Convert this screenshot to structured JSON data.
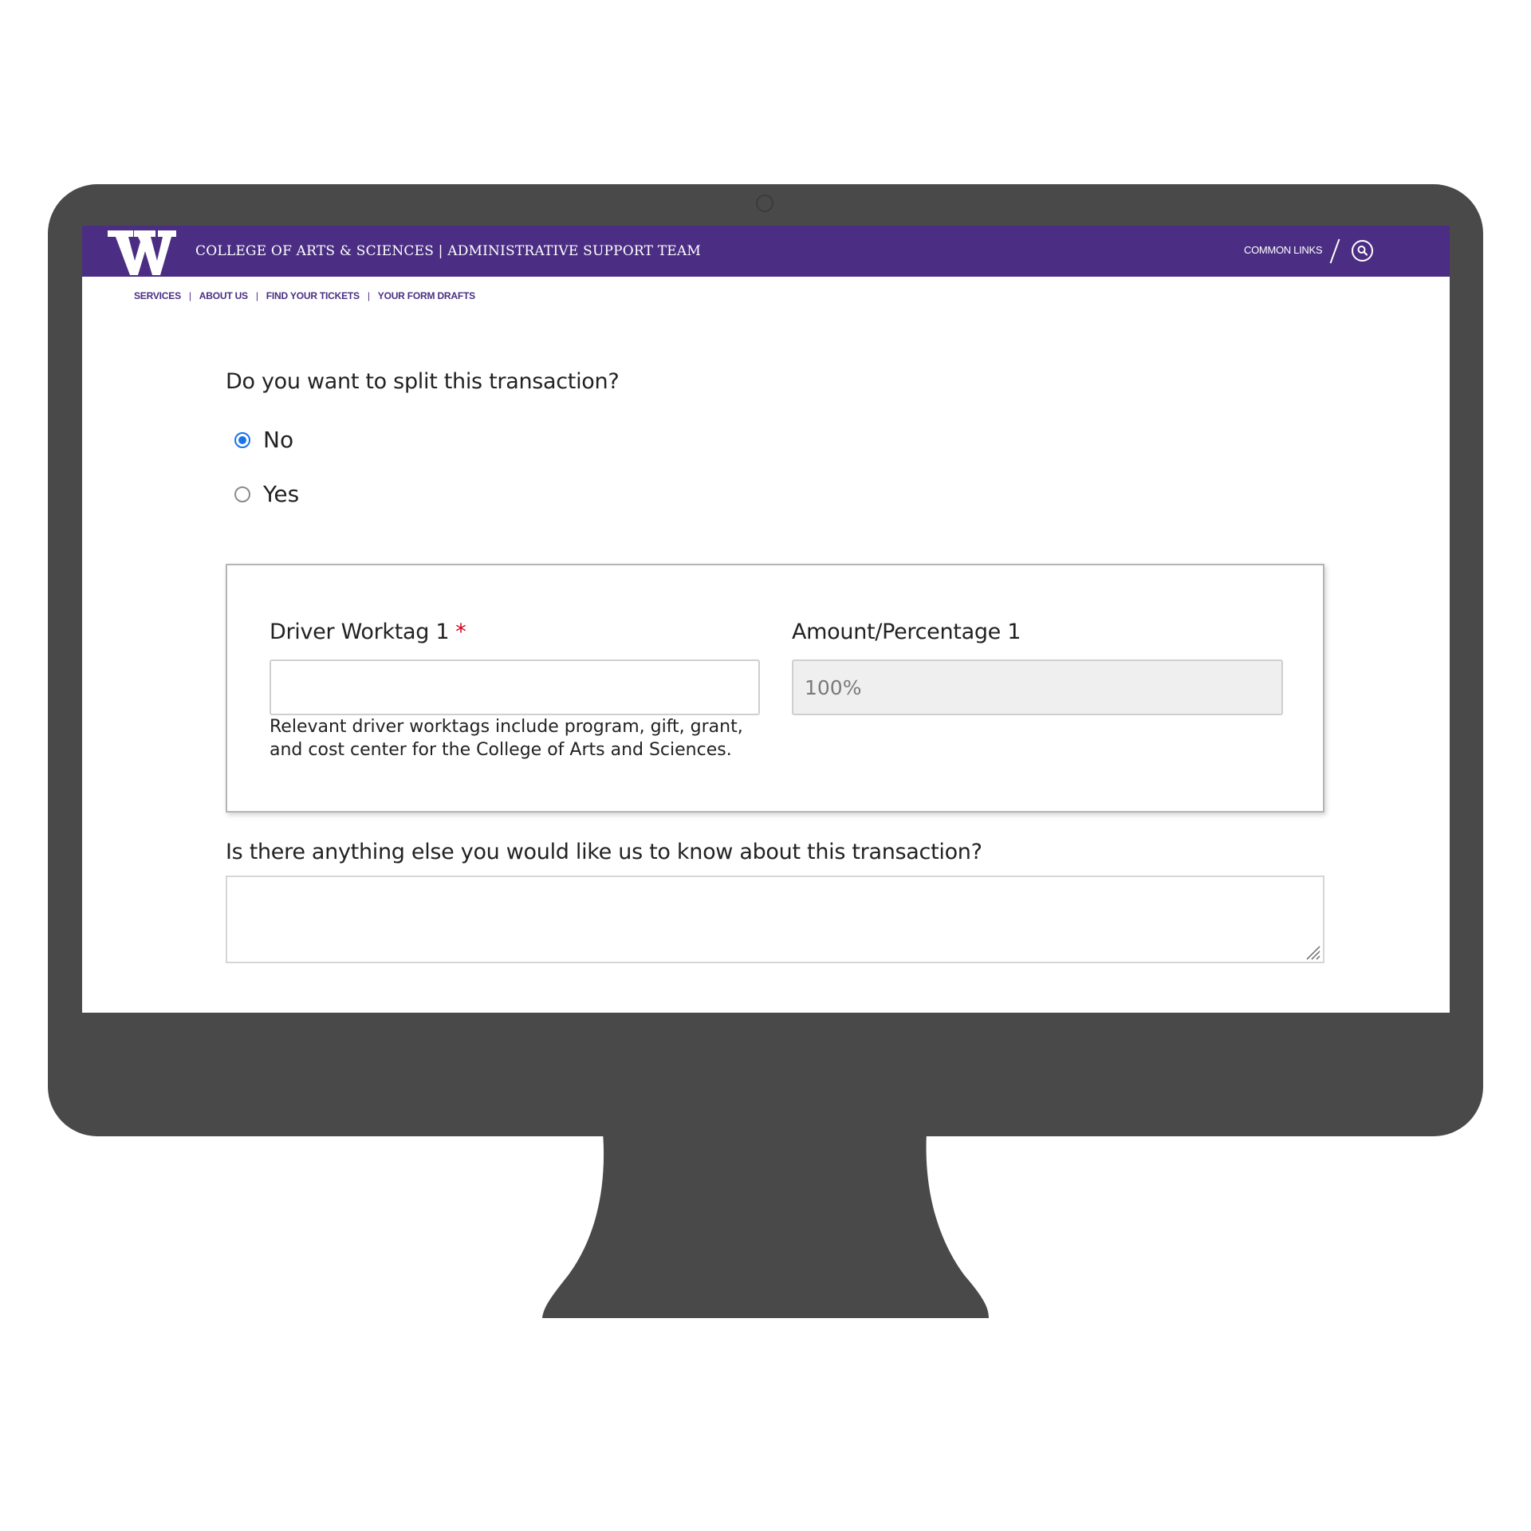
{
  "header": {
    "site_title": "COLLEGE OF ARTS & SCIENCES | ADMINISTRATIVE SUPPORT TEAM",
    "common_links": "COMMON LINKS",
    "brand_color": "#4b2e83"
  },
  "subnav": {
    "items": [
      "SERVICES",
      "ABOUT US",
      "FIND YOUR TICKETS",
      "YOUR FORM DRAFTS"
    ]
  },
  "split_question": {
    "label": "Do you want to split this transaction?",
    "options": [
      {
        "label": "No",
        "selected": true
      },
      {
        "label": "Yes",
        "selected": false
      }
    ]
  },
  "worktag_panel": {
    "driver_label": "Driver Worktag 1",
    "required_mark": "*",
    "driver_value": "",
    "driver_help": "Relevant driver worktags include program, gift, grant, and cost center for the College of Arts and Sciences.",
    "amount_label": "Amount/Percentage 1",
    "amount_value": "100%"
  },
  "notes_question": {
    "label": "Is there anything else you would like us to know about this transaction?",
    "value": ""
  },
  "icons": [
    "uw-w-logo",
    "search-icon",
    "resize-handle-icon"
  ]
}
